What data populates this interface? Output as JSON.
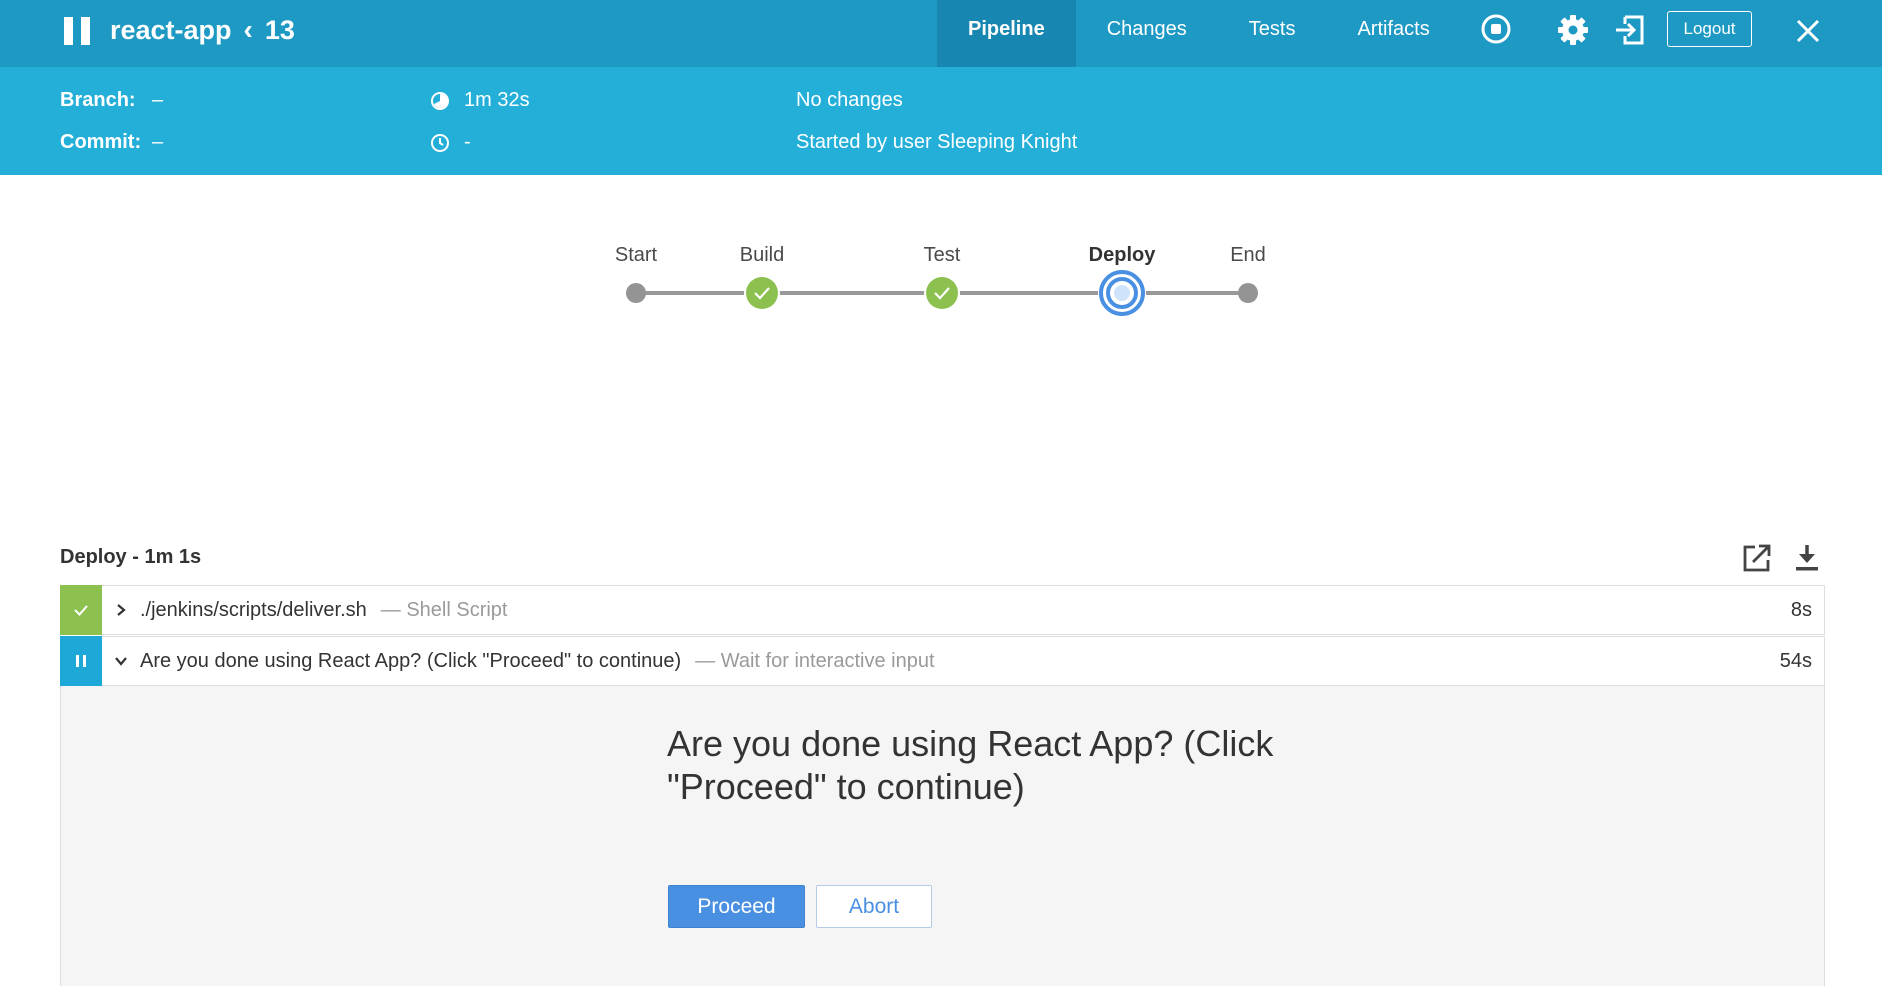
{
  "header": {
    "pause_icon": "pause-icon",
    "app_name": "react-app",
    "run_number": "13",
    "tabs": [
      {
        "label": "Pipeline",
        "active": true
      },
      {
        "label": "Changes",
        "active": false
      },
      {
        "label": "Tests",
        "active": false
      },
      {
        "label": "Artifacts",
        "active": false
      }
    ],
    "icons": [
      "stop-icon",
      "gear-icon",
      "exit-icon",
      "close-icon"
    ],
    "logout_label": "Logout"
  },
  "info": {
    "branch_label": "Branch:",
    "branch_value": "–",
    "commit_label": "Commit:",
    "commit_value": "–",
    "duration": "1m 32s",
    "time": "-",
    "changes": "No changes",
    "started_by": "Started by user Sleeping Knight"
  },
  "pipeline": {
    "stages": [
      {
        "label": "Start",
        "status": "start"
      },
      {
        "label": "Build",
        "status": "success"
      },
      {
        "label": "Test",
        "status": "success"
      },
      {
        "label": "Deploy",
        "status": "running"
      },
      {
        "label": "End",
        "status": "end"
      }
    ]
  },
  "steps_panel": {
    "title": "Deploy - 1m 1s",
    "icons": [
      "open-external-icon",
      "download-icon"
    ],
    "steps": [
      {
        "text": "./jenkins/scripts/deliver.sh",
        "sub": "— Shell Script",
        "duration": "8s",
        "status": "success"
      },
      {
        "text": "Are you done using React App? (Click \"Proceed\" to continue)",
        "sub": "— Wait for interactive input",
        "duration": "54s",
        "status": "paused"
      }
    ],
    "input": {
      "prompt": "Are you done using React App? (Click \"Proceed\" to continue)",
      "proceed_label": "Proceed",
      "abort_label": "Abort"
    }
  },
  "colors": {
    "topbar": "#1e99c4",
    "infobar": "#24afd9",
    "success": "#8cc04f",
    "running": "#4a90e2",
    "paused": "#1ea8d8"
  }
}
